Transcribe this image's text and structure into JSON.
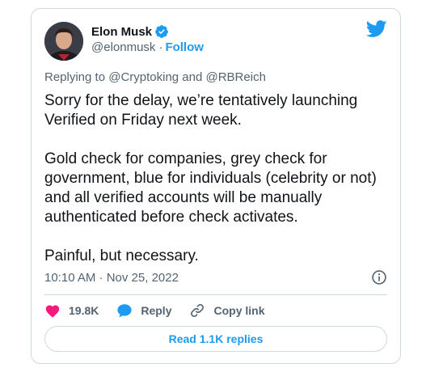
{
  "author": {
    "display_name": "Elon Musk",
    "handle": "@elonmusk",
    "separator": "·",
    "follow_label": "Follow"
  },
  "colors": {
    "accent": "#1d9bf0",
    "like": "#f91880",
    "text": "#0f1419",
    "muted": "#536471"
  },
  "replying": "Replying to @Cryptoking and @RBReich",
  "tweet": {
    "paragraphs": [
      "Sorry for the delay, we’re tentatively launching Verified on Friday next week.",
      "Gold check for companies, grey check for government, blue for individuals (celebrity or not) and all verified accounts will be manually authenticated before check activates.",
      "Painful, but necessary."
    ]
  },
  "timestamp": "10:10 AM · Nov 25, 2022",
  "actions": {
    "like_count": "19.8K",
    "reply_label": "Reply",
    "copy_link_label": "Copy link"
  },
  "read_replies_label": "Read 1.1K replies",
  "icons": [
    "verified-badge-icon",
    "twitter-bird-icon",
    "info-icon",
    "heart-icon",
    "reply-bubble-icon",
    "link-icon"
  ]
}
